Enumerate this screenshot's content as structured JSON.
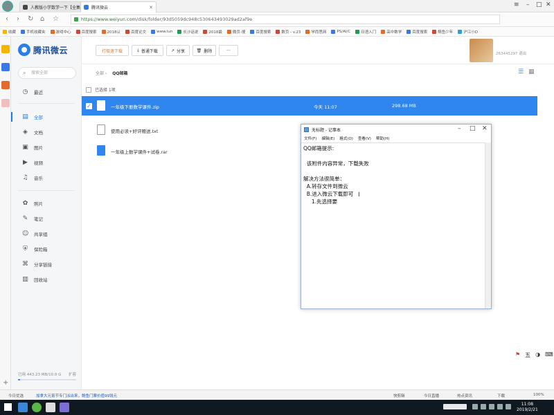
{
  "browser": {
    "tabs": [
      {
        "title": "人教版小学数学一下【全集】",
        "active": false
      },
      {
        "title": "腾讯微云",
        "active": true
      }
    ],
    "url": "https://www.weiyun.com/disk/folder/93d5059dc948c53064349302​9ad2af9e",
    "url_host": "https://www.weiyun.com",
    "url_path": "/disk/folder/93d5059dc948c530643493029ad2af9e",
    "bookmarks": [
      "收藏",
      "手机收藏夹",
      "游戏中心",
      "百度搜索",
      "2018认",
      "百度论文",
      "www.lun",
      "长沙话说",
      "2018最",
      "微页-搜",
      "百度搜索",
      "数页 - v.23",
      "学而思网",
      "PS/AI/C",
      "日语入门",
      "高中数学",
      "百度搜索",
      "鲸鱼少年",
      "沪江小D"
    ]
  },
  "app": {
    "name": "腾讯微云",
    "search_placeholder": "搜索全部",
    "nav_top": {
      "label": "最近",
      "icon": "clock-icon"
    },
    "nav_main": [
      {
        "label": "全部",
        "icon": "document-icon",
        "active": true
      },
      {
        "label": "文档",
        "icon": "layers-icon",
        "active": false
      },
      {
        "label": "图片",
        "icon": "image-icon",
        "active": false
      },
      {
        "label": "视频",
        "icon": "video-icon",
        "active": false
      },
      {
        "label": "音乐",
        "icon": "music-icon",
        "active": false
      }
    ],
    "nav_extra": [
      {
        "label": "照片",
        "icon": "photo-icon"
      },
      {
        "label": "笔记",
        "icon": "note-icon"
      },
      {
        "label": "共享组",
        "icon": "people-icon"
      },
      {
        "label": "保险箱",
        "icon": "shield-icon"
      },
      {
        "label": "分享链接",
        "icon": "link-icon"
      },
      {
        "label": "回收站",
        "icon": "trash-icon"
      }
    ],
    "storage_text": "已用 443.23 MB/10.0 G",
    "storage_used_fraction": 0.04,
    "storage_expand": "扩容"
  },
  "toolbar": {
    "fast_download": "打极速下载",
    "normal_download": "普通下载",
    "share": "分享",
    "delete": "删除",
    "more": "···",
    "username": "263445297 退出"
  },
  "breadcrumb": {
    "root": "全部",
    "current": "QQ邮箱"
  },
  "selection": {
    "text": "已选择 1项"
  },
  "files": [
    {
      "name": "一年级下册数学课件.zip",
      "time": "今天 11:07",
      "size": "298.68 MB",
      "selected": true,
      "icon_color": "#ffffff"
    },
    {
      "name": "使用必读+好评赠送.txt",
      "time": "",
      "size": "",
      "selected": false,
      "icon_color": "#555555"
    },
    {
      "name": "一年级上数学课件+试卷.rar",
      "time": "",
      "size": "",
      "selected": false,
      "icon_color": "#2e86ee"
    }
  ],
  "notepad": {
    "title": "无标题 - 记事本",
    "menu": [
      "文件(F)",
      "编辑(E)",
      "格式(O)",
      "查看(V)",
      "帮助(H)"
    ],
    "content": "QQ邮箱提示:\n\n  该附件内容异常，下载失败\n\n解决方法很简单：\n  A.转存文件到微云\n  B.进入微云下载即可\n     1.先选择要"
  },
  "statusbar": {
    "left": "今日优选",
    "news": "加拿大元宵节专门派出来，鲍鱼门票价值99钱元",
    "right_items": [
      "快剪辑",
      "今日直播",
      "热点资讯",
      "下载",
      "100%"
    ]
  },
  "taskbar": {
    "time": "11:08",
    "date": "2019/2/21"
  },
  "colors": {
    "accent": "#2e86ee",
    "brand": "#1d4e9c",
    "selected_row": "#2e86ee"
  }
}
